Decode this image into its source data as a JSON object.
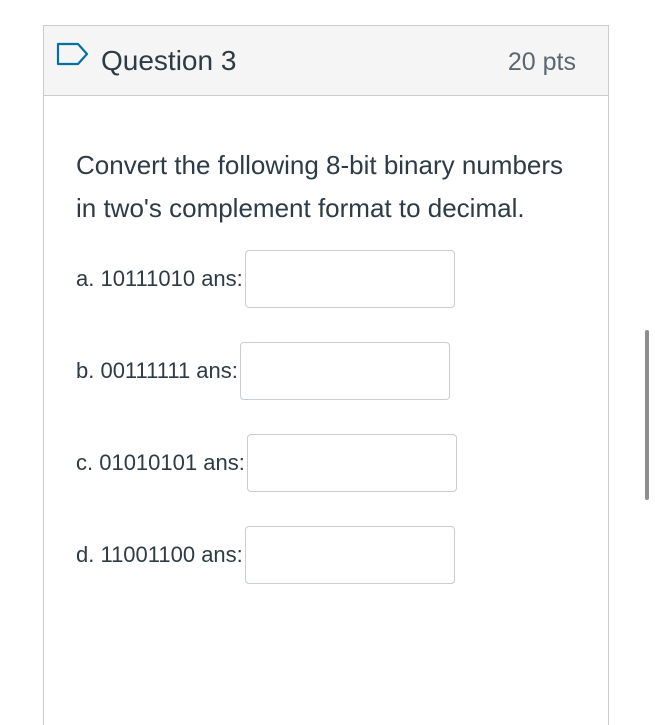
{
  "question": {
    "title": "Question 3",
    "points": "20 pts",
    "prompt": "Convert the following 8-bit binary numbers in two's complement format to decimal.",
    "flag_icon": "flag-outline-icon"
  },
  "answers": [
    {
      "label": "a. 10111010 ans:",
      "value": ""
    },
    {
      "label": "b. 00111111 ans:",
      "value": ""
    },
    {
      "label": "c. 01010101 ans:",
      "value": ""
    },
    {
      "label": "d. 11001100 ans:",
      "value": ""
    }
  ],
  "colors": {
    "header_bg": "#f5f5f5",
    "border": "#c7cdd1",
    "text": "#2d3b45",
    "flag_stroke": "#0770a3"
  }
}
